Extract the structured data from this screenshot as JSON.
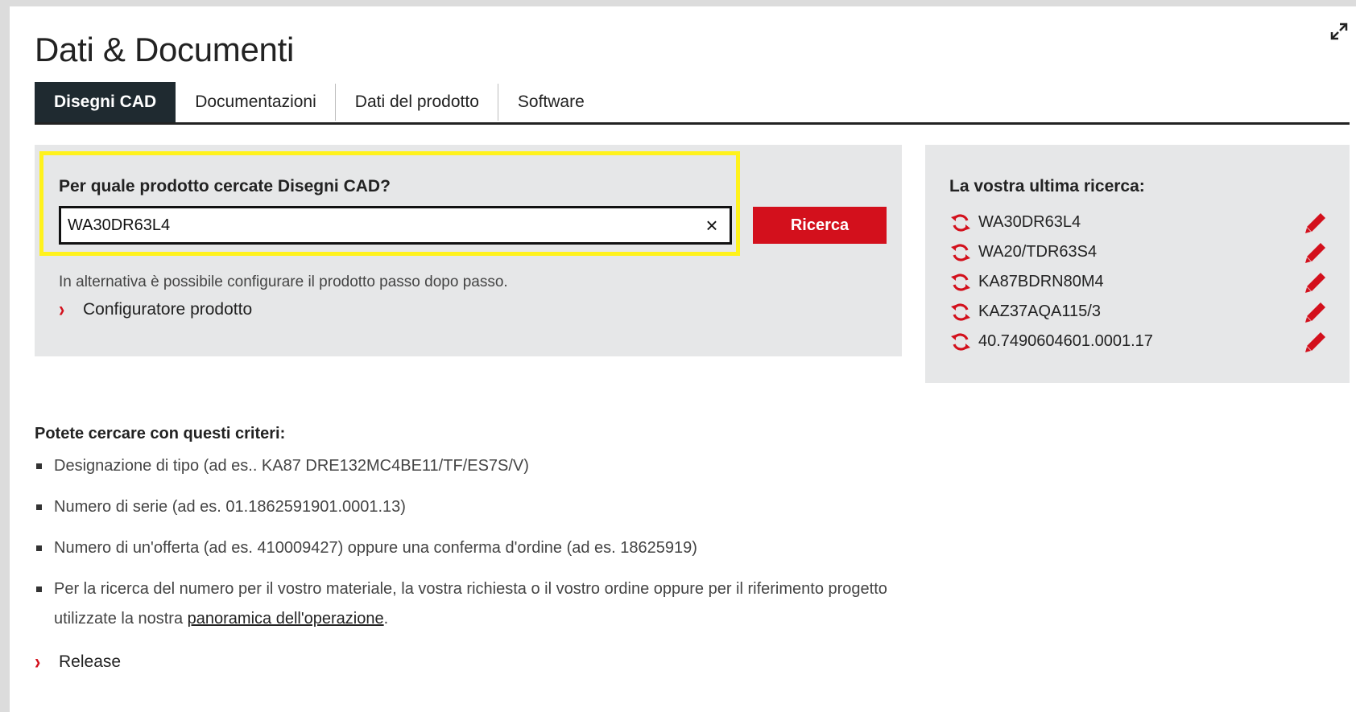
{
  "page": {
    "title": "Dati & Documenti"
  },
  "tabs": [
    {
      "label": "Disegni CAD",
      "active": true
    },
    {
      "label": "Documentazioni",
      "active": false
    },
    {
      "label": "Dati del prodotto",
      "active": false
    },
    {
      "label": "Software",
      "active": false
    }
  ],
  "search": {
    "label": "Per quale prodotto cercate Disegni CAD?",
    "value": "WA30DR63L4",
    "clear_symbol": "×",
    "button_label": "Ricerca",
    "alt_text": "In alternativa è possibile configurare il prodotto passo dopo passo.",
    "configurator_link": "Configuratore prodotto"
  },
  "recent": {
    "title": "La vostra ultima ricerca:",
    "items": [
      {
        "label": "WA30DR63L4"
      },
      {
        "label": "WA20/TDR63S4"
      },
      {
        "label": "KA87BDRN80M4"
      },
      {
        "label": "KAZ37AQA115/3"
      },
      {
        "label": "40.7490604601.0001.17"
      }
    ]
  },
  "criteria": {
    "title": "Potete cercare con questi criteri:",
    "items": [
      "Designazione di tipo (ad es.. KA87 DRE132MC4BE11/TF/ES7S/V)",
      "Numero di serie (ad es. 01.1862591901.0001.13)",
      "Numero di un'offerta (ad es. 410009427) oppure una conferma d'ordine (ad es. 18625919)"
    ],
    "last_item_prefix": "Per la ricerca del numero per il vostro materiale, la vostra richiesta o il vostro ordine oppure per il riferimento progetto utilizzate la nostra ",
    "last_item_link": "panoramica dell'operazione",
    "last_item_suffix": "."
  },
  "release_link": "Release",
  "colors": {
    "accent_red": "#d3101c",
    "active_tab": "#1f2a30",
    "panel_bg": "#e6e7e8",
    "highlight": "#fff21c"
  },
  "icons": {
    "chevron": "›",
    "recent_refresh": "refresh-icon",
    "recent_edit": "pencil-icon",
    "expand": "expand-icon"
  }
}
